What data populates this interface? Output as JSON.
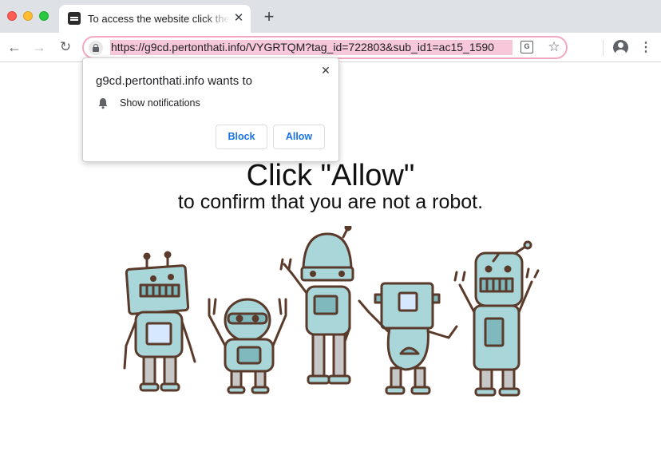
{
  "tab": {
    "title": "To access the website click the \"Allow\" button",
    "close": "✕",
    "new_tab": "+"
  },
  "toolbar": {
    "back": "←",
    "forward": "→",
    "reload": "↻",
    "url": "https://g9cd.pertonthati.info/VYGRTQM?tag_id=722803&sub_id1=ac15_1590",
    "translate": "G",
    "star": "☆",
    "menu": "⋮"
  },
  "popup": {
    "title": "g9cd.pertonthati.info wants to",
    "permission": "Show notifications",
    "close": "✕",
    "block_label": "Block",
    "allow_label": "Allow"
  },
  "page": {
    "headline": "Click \"Allow\"",
    "subline": "to confirm that you are not a robot."
  },
  "colors": {
    "robot_fill": "#a9d6d9",
    "robot_outline": "#5a3a2a",
    "url_highlight": "#f6c8d9",
    "button_text": "#1a73e8"
  }
}
